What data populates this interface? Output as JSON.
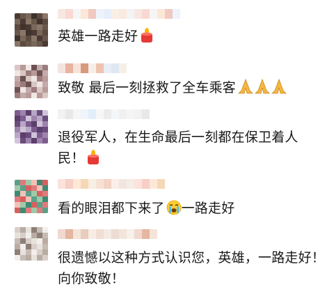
{
  "comments": [
    {
      "text": "英雄一路走好",
      "emoji": "candle-icon",
      "avatar_colors": [
        "#4a3a33",
        "#6a574c",
        "#7a675b",
        "#3f332c",
        "#5c4a40",
        "#8a7667"
      ]
    },
    {
      "text": "致敬 最后一刻拯救了全车乘客",
      "emoji": "praying-hands-icon",
      "avatar_colors": [
        "#d8c7c3",
        "#b89b98",
        "#f0e6e4",
        "#6d5252",
        "#c3abab",
        "#9c7c7c"
      ]
    },
    {
      "text": "退役军人，在生命最后一刻都在保卫着人民！",
      "emoji": "candle-icon",
      "avatar_colors": [
        "#7d5d8f",
        "#9d84ad",
        "#5c3f6c",
        "#b8a6c6",
        "#6b4c7c",
        "#d0c3da"
      ]
    },
    {
      "text_before": "看的眼泪都下来了",
      "text_after": "一路走好",
      "emoji": "crying-face-icon",
      "avatar_colors": [
        "#5aa08a",
        "#e07b7b",
        "#9fc9a8",
        "#f2c2b8",
        "#3f8a73",
        "#d95f5f"
      ]
    },
    {
      "text": "很遗憾以这种方式认识您，英雄，一路走好！向你致敬！",
      "avatar_colors": [
        "#d9cfc8",
        "#b9aca3",
        "#e8e2dd",
        "#8e8078",
        "#c7bcb4",
        "#f2eeeb"
      ]
    }
  ],
  "colors": {
    "text": "#1a1a1a",
    "candle_body": "#e53935",
    "candle_flame": "#ffb300",
    "hands": "#f5b642"
  }
}
